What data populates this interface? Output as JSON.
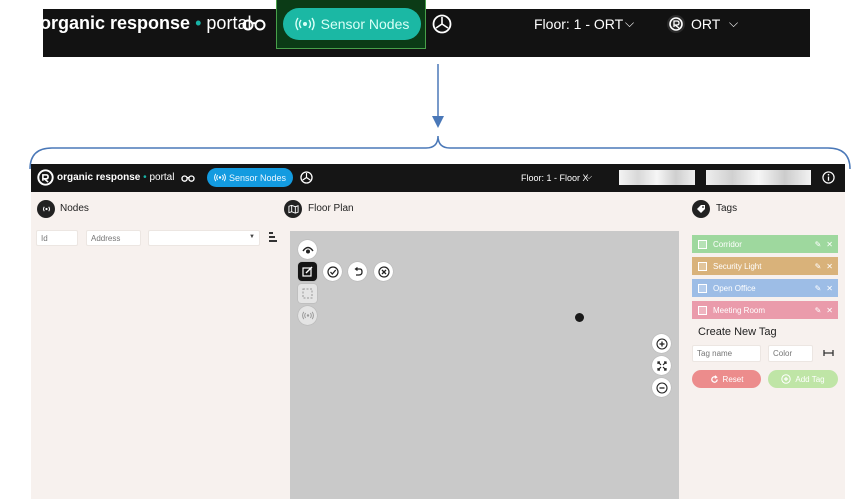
{
  "zoom_header": {
    "logo_brand": "organic",
    "logo_response": "response",
    "logo_dot": "•",
    "logo_portal": "portal",
    "sensor_nodes_label": "Sensor Nodes",
    "floor_label": "Floor: 1 - ORT",
    "user_label": "ORT",
    "highlight_color": "#48a04a",
    "accent_color": "#1bb8a4"
  },
  "app": {
    "header": {
      "logo_brand": "organic",
      "logo_response": "response",
      "logo_dot": "•",
      "logo_portal": "portal",
      "sensor_nodes_label": "Sensor Nodes",
      "floor_label": "Floor: 1 - Floor X",
      "accent_color": "#139be0"
    },
    "nodes_panel": {
      "title": "Nodes",
      "id_placeholder": "Id",
      "address_placeholder": "Address",
      "type_select_value": ""
    },
    "floor_plan": {
      "title": "Floor Plan"
    },
    "tags_panel": {
      "title": "Tags",
      "tags": [
        {
          "name": "Corridor",
          "color": "#9ed89e"
        },
        {
          "name": "Security Light",
          "color": "#d9b27a"
        },
        {
          "name": "Open Office",
          "color": "#9dbde6"
        },
        {
          "name": "Meeting Room",
          "color": "#ea9bab"
        }
      ],
      "create_title": "Create New Tag",
      "tag_name_placeholder": "Tag name",
      "color_placeholder": "Color",
      "reset_label": "Reset",
      "add_tag_label": "Add Tag",
      "reset_color": "#ec8c8c",
      "add_tag_color": "#bfe5a6"
    }
  }
}
